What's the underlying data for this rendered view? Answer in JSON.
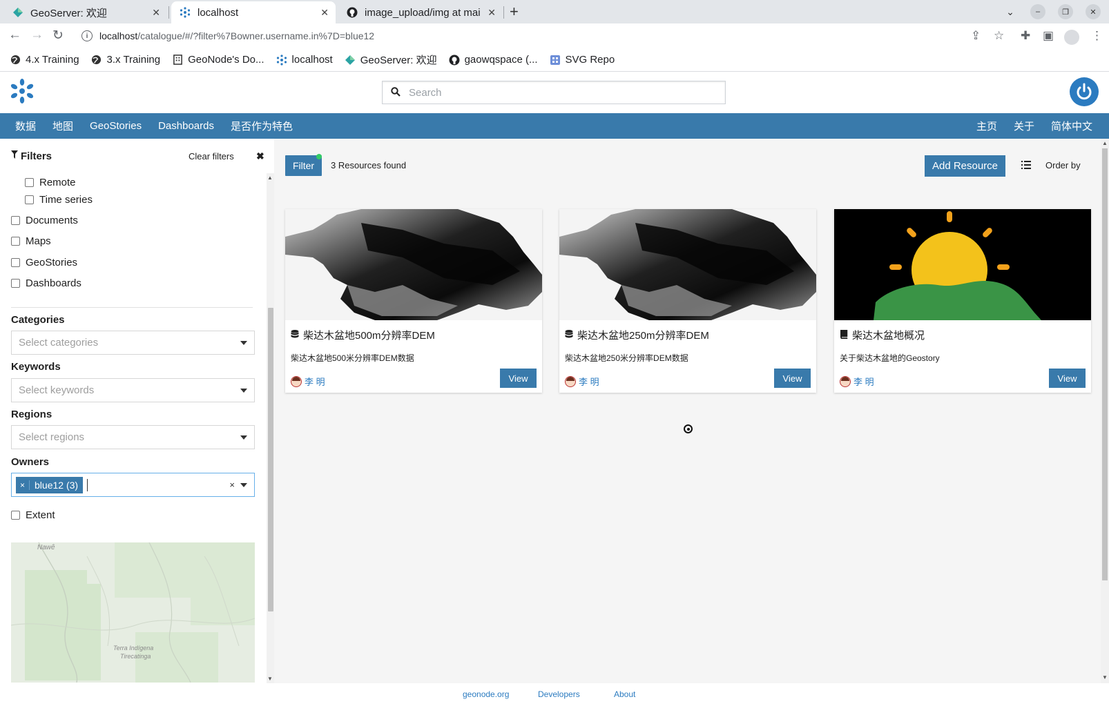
{
  "browser": {
    "tabs": [
      {
        "title": "GeoServer: 欢迎",
        "icon": "geoserver-icon"
      },
      {
        "title": "localhost",
        "icon": "geonode-icon"
      },
      {
        "title": "image_upload/img at mai",
        "icon": "github-icon"
      }
    ],
    "url": {
      "host": "localhost",
      "path": "/catalogue/#/?filter%7Bowner.username.in%7D=blue12"
    },
    "bookmarks": [
      {
        "label": "4.x Training",
        "icon": "globe-icon"
      },
      {
        "label": "3.x Training",
        "icon": "globe-icon"
      },
      {
        "label": "GeoNode's Do...",
        "icon": "building-icon"
      },
      {
        "label": "localhost",
        "icon": "geonode-icon"
      },
      {
        "label": "GeoServer: 欢迎",
        "icon": "geoserver-icon"
      },
      {
        "label": "gaowqspace (...",
        "icon": "github-icon"
      },
      {
        "label": "SVG Repo",
        "icon": "svgrepo-icon"
      }
    ]
  },
  "header": {
    "search_placeholder": "Search"
  },
  "menu": {
    "left": [
      "数据",
      "地图",
      "GeoStories",
      "Dashboards",
      "是否作为特色"
    ],
    "right": [
      "主页",
      "关于",
      "简体中文"
    ]
  },
  "filters": {
    "title": "Filters",
    "clear": "Clear filters",
    "sub_types": [
      "Remote",
      "Time series"
    ],
    "types": [
      "Documents",
      "Maps",
      "GeoStories",
      "Dashboards"
    ],
    "categories": {
      "label": "Categories",
      "placeholder": "Select categories"
    },
    "keywords": {
      "label": "Keywords",
      "placeholder": "Select keywords"
    },
    "regions": {
      "label": "Regions",
      "placeholder": "Select regions"
    },
    "owners": {
      "label": "Owners",
      "selected": "blue12 (3)",
      "remove": "×",
      "clear": "×"
    },
    "extent": "Extent",
    "map_labels": [
      "Nawê",
      "Terra Indígena",
      "Tirecatinga"
    ]
  },
  "toolbar": {
    "filter": "Filter",
    "found": "3 Resources found",
    "add": "Add Resource",
    "order_by": "Order by"
  },
  "cards": [
    {
      "title": "柴达木盆地500m分辨率DEM",
      "desc": "柴达木盆地500米分辨率DEM数据",
      "owner": "李 明",
      "view": "View",
      "type_icon": "database-icon"
    },
    {
      "title": "柴达木盆地250m分辨率DEM",
      "desc": "柴达木盆地250米分辨率DEM数据",
      "owner": "李 明",
      "view": "View",
      "type_icon": "database-icon"
    },
    {
      "title": "柴达木盆地概况",
      "desc": "关于柴达木盆地的Geostory",
      "owner": "李 明",
      "view": "View",
      "type_icon": "book-icon"
    }
  ],
  "footer": [
    "geonode.org",
    "Developers",
    "About"
  ],
  "colors": {
    "primary": "#397aab",
    "link": "#2b7bc0",
    "sun": "#f3c21b",
    "hill": "#3a9446"
  }
}
